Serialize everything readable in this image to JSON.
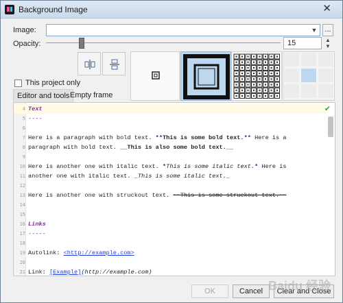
{
  "window": {
    "title": "Background Image"
  },
  "form": {
    "image_label": "Image:",
    "image_value": "",
    "browse_label": "...",
    "opacity_label": "Opacity:",
    "opacity_value": "15",
    "project_only_label": "This project only"
  },
  "tabs": [
    {
      "label": "Editor and tools",
      "active": true
    },
    {
      "label": "Empty frame",
      "active": false
    }
  ],
  "editor": {
    "lines": [
      {
        "n": "4",
        "text": "Text"
      },
      {
        "n": "5",
        "text": "----"
      },
      {
        "n": "6",
        "text": ""
      },
      {
        "n": "7",
        "pre": "Here is a paragraph with bold text. ",
        "mk1": "**",
        "bold": "This is some bold text.",
        "mk2": "**",
        "post": " Here is a"
      },
      {
        "n": "8",
        "pre": "paragraph with bold text. ",
        "mk1": "__",
        "bold": "This is also some bold text.",
        "mk2": "__",
        "post": ""
      },
      {
        "n": "9",
        "text": ""
      },
      {
        "n": "10",
        "pre": "Here is another one with italic text. ",
        "mk1": "*",
        "ital": "This is some italic text.",
        "mk2": "*",
        "post": " Here is"
      },
      {
        "n": "11",
        "pre": "another one with italic text. ",
        "mk1": "_",
        "ital": "This is some italic text.",
        "mk2": "_",
        "post": ""
      },
      {
        "n": "12",
        "text": ""
      },
      {
        "n": "13",
        "pre": "Here is another one with struckout text. ",
        "strike": "~~This is some struckout text.~~"
      },
      {
        "n": "14",
        "text": ""
      },
      {
        "n": "15",
        "text": ""
      },
      {
        "n": "16",
        "text": "Links"
      },
      {
        "n": "17",
        "text": "-----"
      },
      {
        "n": "18",
        "text": ""
      },
      {
        "n": "19",
        "pre": "Autolink: ",
        "link": "<http://example.com>"
      },
      {
        "n": "20",
        "text": ""
      },
      {
        "n": "21",
        "pre": "Link: ",
        "link": "[Example]",
        "post": "(http://example.com)"
      }
    ]
  },
  "buttons": {
    "ok": "OK",
    "cancel": "Cancel",
    "clear_close": "Clear and Close"
  },
  "watermark": "Baidu 经验"
}
